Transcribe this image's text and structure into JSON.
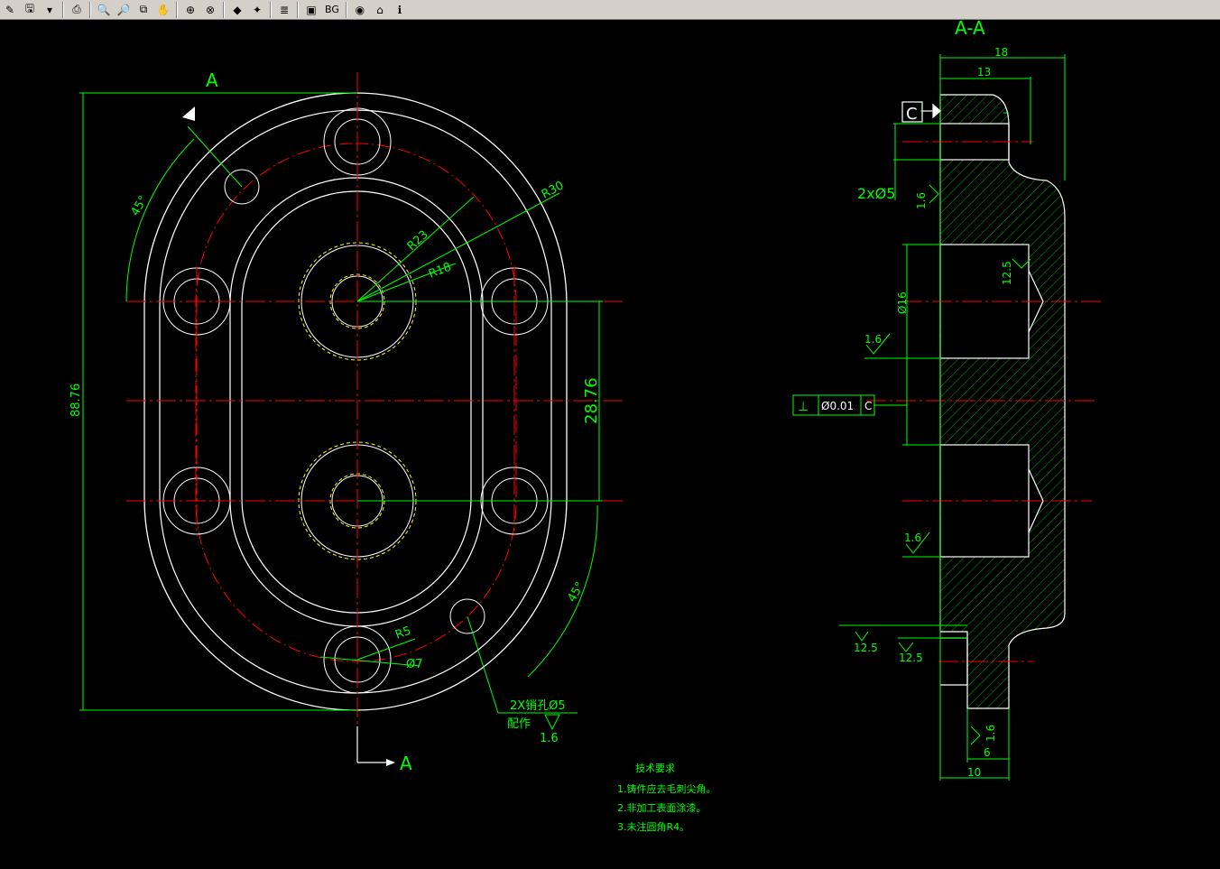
{
  "toolbar": {
    "buttons": [
      {
        "name": "pen-icon",
        "glyph": "✎"
      },
      {
        "name": "save-icon",
        "glyph": "🖫"
      },
      {
        "name": "dropdown-icon",
        "glyph": "▾"
      },
      {
        "name": "print-icon",
        "glyph": "⎙"
      },
      {
        "name": "zoom-out-icon",
        "glyph": "🔍"
      },
      {
        "name": "zoom-in-icon",
        "glyph": "🔎"
      },
      {
        "name": "zoom-window-icon",
        "glyph": "⧉"
      },
      {
        "name": "pan-icon",
        "glyph": "✋"
      },
      {
        "name": "zoom-extents-icon",
        "glyph": "⊕"
      },
      {
        "name": "zoom-previous-icon",
        "glyph": "⊗"
      },
      {
        "name": "turtle-icon",
        "glyph": "◆"
      },
      {
        "name": "measure-icon",
        "glyph": "✦"
      },
      {
        "name": "layers-icon",
        "glyph": "≣"
      },
      {
        "name": "view-icon",
        "glyph": "▣"
      },
      {
        "name": "background-icon",
        "glyph": "BG"
      },
      {
        "name": "color-icon",
        "glyph": "◉"
      },
      {
        "name": "home-icon",
        "glyph": "⌂"
      },
      {
        "name": "info-icon",
        "glyph": "ℹ"
      }
    ]
  },
  "drawing": {
    "colors": {
      "background": "#000000",
      "geometry": "#ffffff",
      "dimension": "#00ff00",
      "center": "#ff0000",
      "thread": "#ffff00",
      "hatch": "#00aa00"
    },
    "front_view": {
      "section_label_top": "A",
      "section_label_bottom": "A",
      "dim_height": "88.76",
      "dim_center_distance": "28.76",
      "angle_top": "45°",
      "angle_bottom": "45°",
      "radius_30": "R30",
      "radius_23": "R23",
      "radius_18": "R18",
      "radius_5": "R5",
      "hole_dia_7": "Ø7",
      "pin_hole_note": "2X销孔Ø5",
      "pin_hole_note2": "配作",
      "pin_hole_roughness": "1.6"
    },
    "section_view": {
      "title": "A-A",
      "dim_18": "18",
      "dim_13": "13",
      "datum": "C",
      "holes_note": "2xØ5",
      "roughness_top": "1.6",
      "roughness_bore": "12.5",
      "dia_16": "Ø16",
      "roughness_left1": "1.6",
      "tol_symbol": "⊥",
      "tol_value": "Ø0.01",
      "tol_datum": "C",
      "roughness_left2": "1.6",
      "roughness_bottom1": "12.5",
      "roughness_bottom2": "12.5",
      "roughness_boss": "1.6",
      "dim_6": "6",
      "dim_10": "10"
    },
    "notes": {
      "title": "技术要求",
      "items": [
        "1.铸件应去毛刺尖角。",
        "2.非加工表面涂漆。",
        "3.未注圆角R4。"
      ]
    }
  }
}
